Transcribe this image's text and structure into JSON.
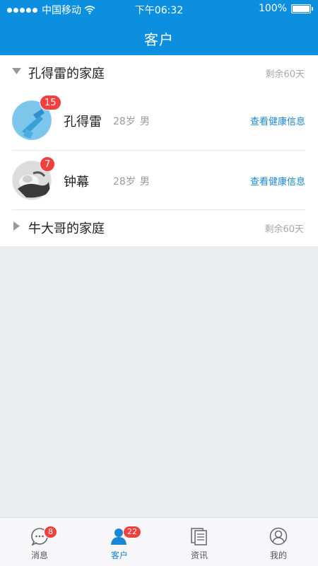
{
  "status_bar": {
    "carrier": "中国移动",
    "time": "下午06:32",
    "battery": "100%",
    "icons": [
      "signal-dots-icon",
      "wifi-icon",
      "battery-icon"
    ]
  },
  "nav": {
    "title": "客户"
  },
  "families": [
    {
      "name": "孔得雷的家庭",
      "remaining": "剩余60天",
      "expanded": true,
      "members": [
        {
          "name": "孔得雷",
          "age": "28岁",
          "gender": "男",
          "badge": "15",
          "link": "查看健康信息"
        },
        {
          "name": "钟幕",
          "age": "28岁",
          "gender": "男",
          "badge": "7",
          "link": "查看健康信息"
        }
      ]
    },
    {
      "name": "牛大哥的家庭",
      "remaining": "剩余60天",
      "expanded": false,
      "members": []
    }
  ],
  "tabs": [
    {
      "label": "消息",
      "icon": "chat-icon",
      "badge": "8",
      "active": false
    },
    {
      "label": "客户",
      "icon": "person-icon",
      "badge": "22",
      "active": true
    },
    {
      "label": "资讯",
      "icon": "news-icon",
      "badge": "",
      "active": false
    },
    {
      "label": "我的",
      "icon": "profile-icon",
      "badge": "",
      "active": false
    }
  ],
  "colors": {
    "primary": "#0d8fe0",
    "badge": "#f2403d",
    "link": "#1a86d6",
    "background": "#ebecee"
  }
}
